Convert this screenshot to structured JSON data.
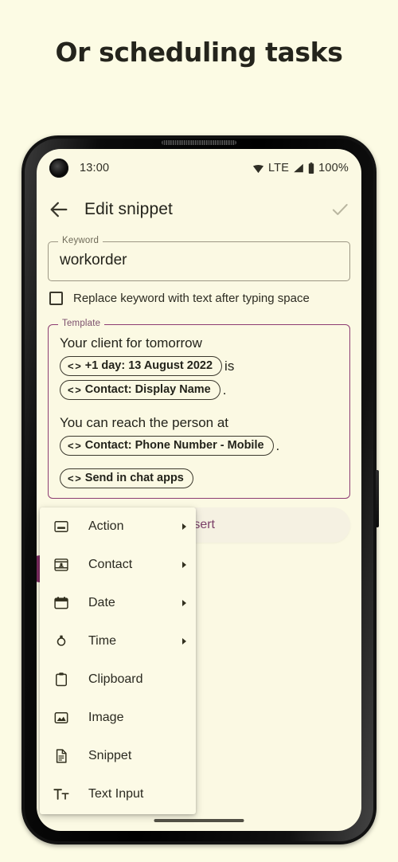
{
  "headline": "Or scheduling tasks",
  "status_bar": {
    "time": "13:00",
    "network_label": "LTE",
    "battery_label": "100%",
    "wifi_icon": "wifi-icon",
    "signal_icon": "cell-signal-icon",
    "battery_icon": "battery-icon",
    "camera_icon": "front-camera-punch-hole"
  },
  "app_bar": {
    "back_icon": "back-arrow-icon",
    "title": "Edit snippet",
    "confirm_icon": "checkmark-icon"
  },
  "keyword_field": {
    "label": "Keyword",
    "value": "workorder",
    "placeholder": "Keyword"
  },
  "replace_option": {
    "label": "Replace keyword with text after typing space",
    "checked": false
  },
  "template_field": {
    "label": "Template",
    "blocks": [
      {
        "type": "text",
        "text": "Your client for tomorrow"
      },
      {
        "type": "chip",
        "glyph": "< >",
        "text": "+1 day: 13 August 2022",
        "tail": "is"
      },
      {
        "type": "chip",
        "glyph": "< >",
        "text": "Contact: Display Name",
        "tail": "."
      },
      {
        "type": "spacer"
      },
      {
        "type": "text",
        "text": "You can reach the person at"
      },
      {
        "type": "chip",
        "glyph": "< >",
        "text": "Contact: Phone Number - Mobile",
        "tail": "."
      },
      {
        "type": "spacer"
      },
      {
        "type": "chip",
        "glyph": "< >",
        "text": "Send in chat apps",
        "tail": ""
      }
    ]
  },
  "insert_button": {
    "label": "Insert"
  },
  "menu": {
    "items": [
      {
        "label": "Action",
        "icon": "action-bar-icon",
        "has_submenu": true
      },
      {
        "label": "Contact",
        "icon": "contact-card-icon",
        "has_submenu": true
      },
      {
        "label": "Date",
        "icon": "calendar-icon",
        "has_submenu": true
      },
      {
        "label": "Time",
        "icon": "watch-icon",
        "has_submenu": true
      },
      {
        "label": "Clipboard",
        "icon": "clipboard-icon",
        "has_submenu": false
      },
      {
        "label": "Image",
        "icon": "image-icon",
        "has_submenu": false
      },
      {
        "label": "Snippet",
        "icon": "document-icon",
        "has_submenu": false
      },
      {
        "label": "Text Input",
        "icon": "text-input-icon",
        "has_submenu": false
      }
    ]
  },
  "colors": {
    "page_background": "#fcfbe4",
    "screen_background": "#fbf9e3",
    "accent_purple": "#8d3c72",
    "fab_purple": "#7e2d63",
    "text_primary": "#24241c",
    "outline": "#9c9784"
  }
}
